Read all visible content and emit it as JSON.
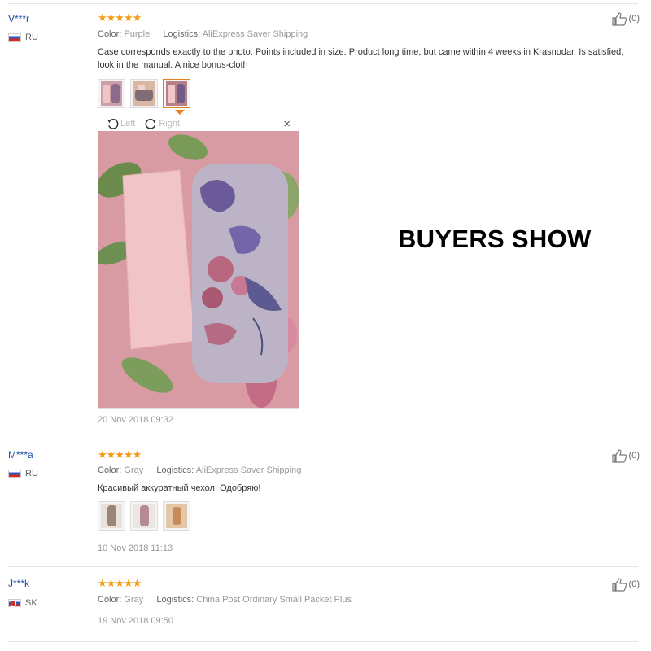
{
  "banner": "BUYERS SHOW",
  "rating_stars": "★★★★★",
  "color_label": "Color:",
  "logistics_label": "Logistics:",
  "viewer": {
    "left": "Left",
    "right": "Right",
    "close": "×"
  },
  "reviews": [
    {
      "user": "V***r",
      "country": "RU",
      "color": "Purple",
      "logistics": "AliExpress Saver Shipping",
      "text": "Case corresponds exactly to the photo. Points included in size. Product long time, but came within 4 weeks in Krasnodar. Is satisfied, look in the manual. A nice bonus-cloth",
      "date": "20 Nov 2018 09:32",
      "likes": "(0)"
    },
    {
      "user": "M***a",
      "country": "RU",
      "color": "Gray",
      "logistics": "AliExpress Saver Shipping",
      "text": "Красивый аккуратный чехол! Одобряю!",
      "date": "10 Nov 2018 11:13",
      "likes": "(0)"
    },
    {
      "user": "J***k",
      "country": "SK",
      "color": "Gray",
      "logistics": "China Post Ordinary Small Packet Plus",
      "date": "19 Nov 2018 09:50",
      "likes": "(0)"
    }
  ],
  "icons": {
    "like": "thumbs-up-icon",
    "rotate_left": "rotate-left-icon",
    "rotate_right": "rotate-right-icon",
    "close": "close-icon"
  },
  "colors": {
    "star": "#f39c12",
    "link": "#1a4fa3",
    "accent": "#e67e22"
  }
}
